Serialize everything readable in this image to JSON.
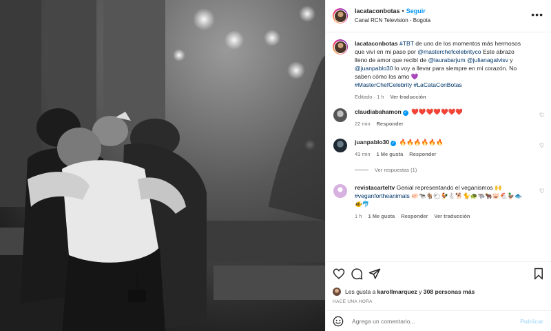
{
  "header": {
    "username": "lacataconbotas",
    "separator": "•",
    "follow_label": "Seguir",
    "location": "Canal RCN Television - Bogota",
    "more_icon": "more-horizontal-icon"
  },
  "caption": {
    "username": "lacataconbotas",
    "tbt": "#TBT",
    "t1": " de uno de los momentos más hermosos que viví en mi paso por ",
    "m1": "@masterchefcelebrityco",
    "t2": " Este abrazo lleno de amor que recibí de ",
    "m2": "@laurabarjum",
    "m3": "@julianagalvisv",
    "t3": " y ",
    "m4": "@juanpablo30",
    "t4": " lo voy a llevar para siempre en mi corazón. No saben cómo los amo 💜",
    "tag1": "#MasterChefCelebrity",
    "tag2": "#LaCataConBotas",
    "edited": "Editado · 1 h",
    "see_translation": "Ver traducción"
  },
  "comments": [
    {
      "username": "claudiabahamon",
      "verified": true,
      "text": "❤️❤️❤️❤️❤️❤️❤️",
      "time": "22 min",
      "reply": "Responder"
    },
    {
      "username": "juanpablo30",
      "verified": true,
      "text": "🔥🔥🔥🔥🔥🔥",
      "time": "43 min",
      "likes": "1 Me gusta",
      "reply": "Responder",
      "view_replies": "Ver respuestas (1)"
    },
    {
      "username": "revistacarteltv",
      "verified": false,
      "text": " Genial representando el veganismos 🙌",
      "tag": "#veganfortheanimals",
      "emojis": " 🐖🐄🐐🐑🐓🐇🐕🐈🐢🐃🐂🐷🐔🦆🐟🐠🐬",
      "time": "1 h",
      "likes": "1 Me gusta",
      "reply": "Responder",
      "see_translation": "Ver traducción"
    }
  ],
  "likes": {
    "prefix": "Les gusta a ",
    "user": "karollmarquez",
    "middle": " y ",
    "others": "308 personas más"
  },
  "posted_ago": "HACE UNA HORA",
  "add_comment": {
    "placeholder": "Agrega un comentario...",
    "publish_label": "Publicar"
  },
  "colors": {
    "link": "#0095f6",
    "mention": "#00376b",
    "muted": "#737373"
  }
}
